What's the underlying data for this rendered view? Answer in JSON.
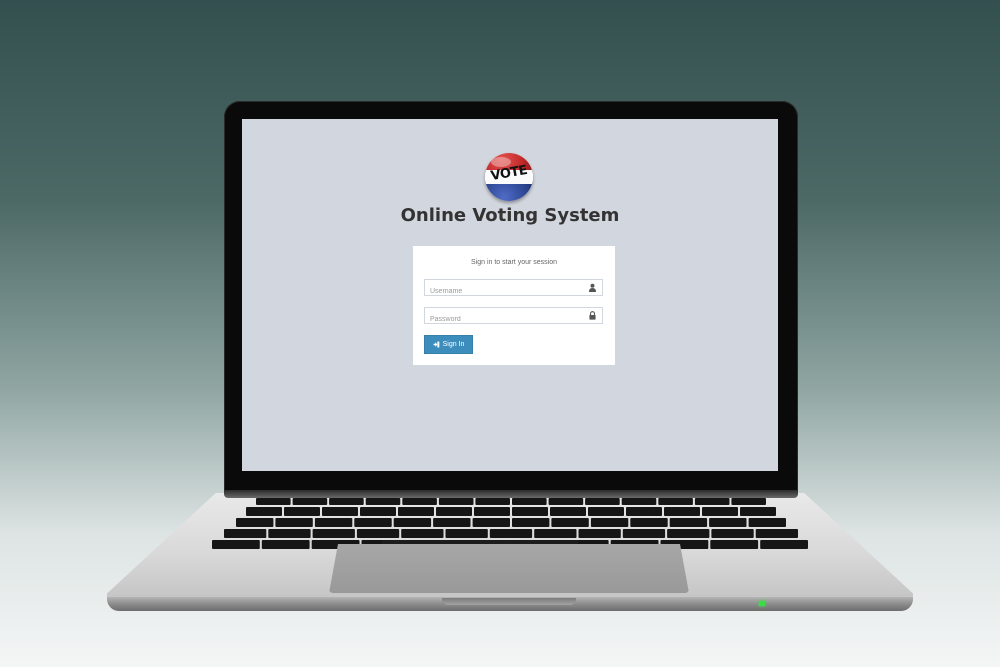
{
  "app": {
    "title": "Online Voting System",
    "logo_text": "VOTE"
  },
  "login": {
    "message": "Sign in to start your session",
    "username_placeholder": "Username",
    "password_placeholder": "Password",
    "signin_label": "Sign In"
  },
  "icons": {
    "username": "user-icon",
    "password": "lock-icon",
    "signin": "sign-in-icon"
  },
  "colors": {
    "screen_bg": "#d2d6de",
    "primary_button": "#3c8dbc",
    "title_text": "#333333",
    "power_led": "#3cdc46"
  }
}
